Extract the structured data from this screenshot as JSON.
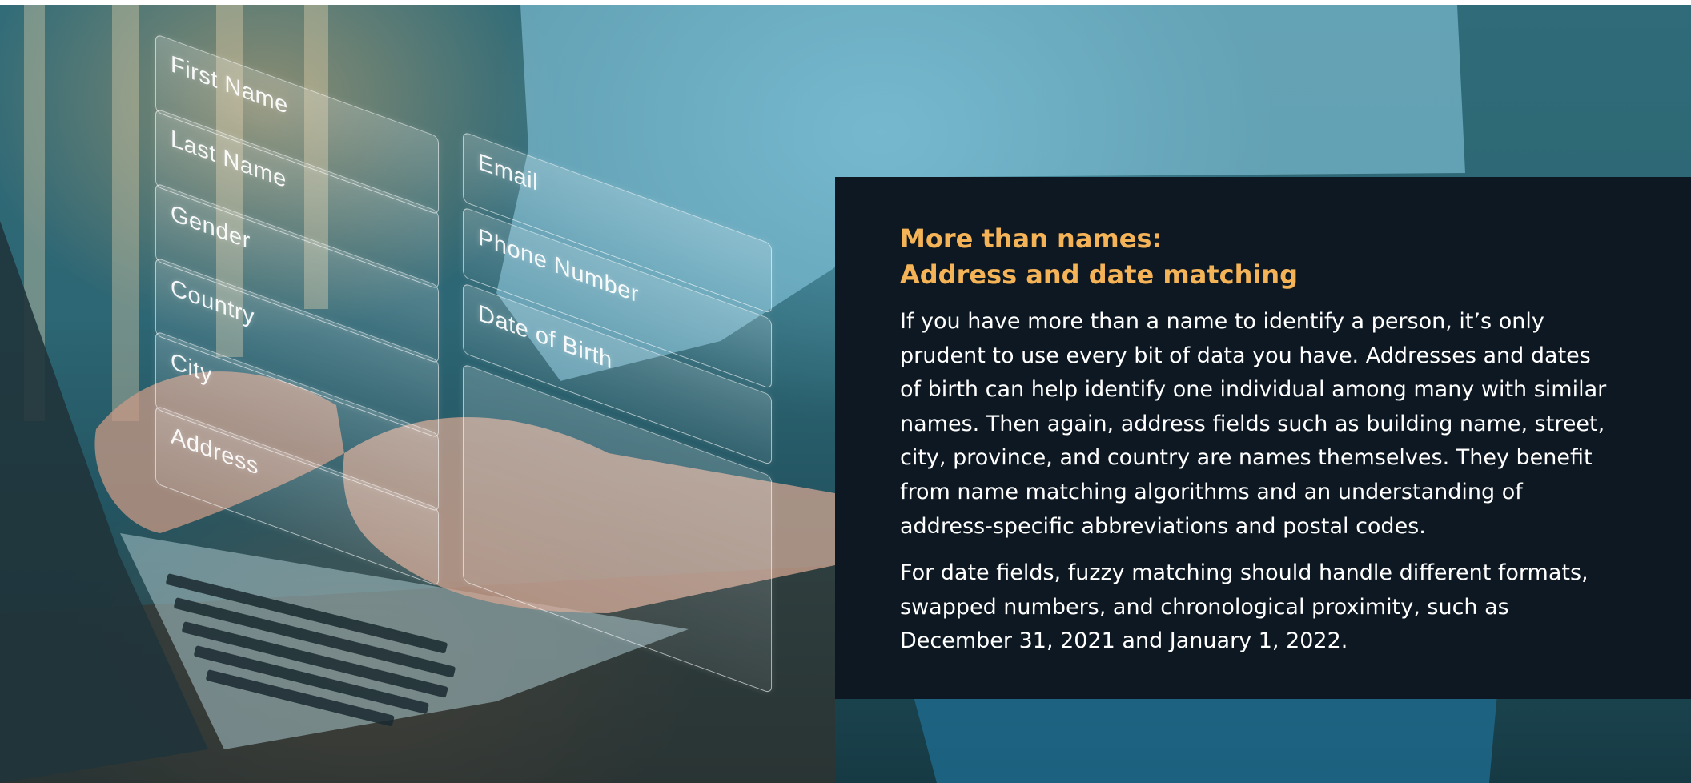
{
  "form_fields": {
    "first_name": "First Name",
    "last_name": "Last Name",
    "gender": "Gender",
    "country": "Country",
    "city": "City",
    "address": "Address",
    "email": "Email",
    "phone_number": "Phone Number",
    "date_of_birth": "Date of Birth"
  },
  "card": {
    "heading_line1": "More than names:",
    "heading_line2": "Address and date matching",
    "paragraph1": "If you have more than a name to identify a person, it’s only prudent to use every bit of data you have. Addresses and dates of birth can help identify one individual among many with similar names. Then again, address fields such as building name, street, city, province, and country are names themselves. They benefit from name matching algorithms and an understanding of address-specific abbreviations and postal codes.",
    "paragraph2": "For date fields, fuzzy matching should handle different formats, swapped numbers, and chronological proximity, such as December 31, 2021 and January 1, 2022."
  },
  "colors": {
    "card_background": "#0d1822",
    "heading_accent": "#f5b357",
    "body_text": "#ffffff"
  }
}
